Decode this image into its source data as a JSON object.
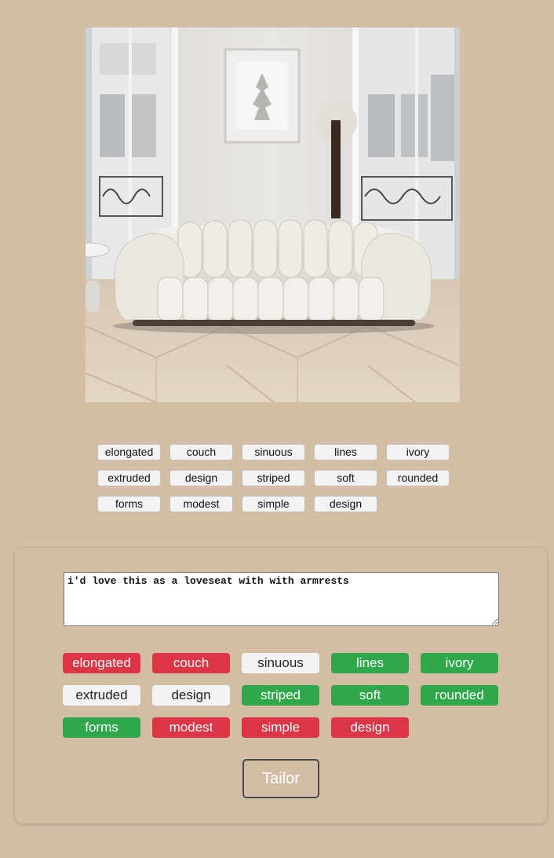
{
  "photo": {
    "subject": "white channel-tufted curved sofa in a bright room"
  },
  "suggested_tags": [
    {
      "label": "elongated"
    },
    {
      "label": "couch"
    },
    {
      "label": "sinuous"
    },
    {
      "label": "lines"
    },
    {
      "label": "ivory"
    },
    {
      "label": "extruded"
    },
    {
      "label": "design"
    },
    {
      "label": "striped"
    },
    {
      "label": "soft"
    },
    {
      "label": "rounded"
    },
    {
      "label": "forms"
    },
    {
      "label": "modest"
    },
    {
      "label": "simple"
    },
    {
      "label": "design"
    }
  ],
  "request": {
    "value": "i'd love this as a loveseat with with armrests"
  },
  "selected_tags": [
    {
      "label": "elongated",
      "state": "red"
    },
    {
      "label": "couch",
      "state": "red"
    },
    {
      "label": "sinuous",
      "state": "neutral"
    },
    {
      "label": "lines",
      "state": "green"
    },
    {
      "label": "ivory",
      "state": "green"
    },
    {
      "label": "extruded",
      "state": "neutral"
    },
    {
      "label": "design",
      "state": "neutral"
    },
    {
      "label": "striped",
      "state": "green"
    },
    {
      "label": "soft",
      "state": "green"
    },
    {
      "label": "rounded",
      "state": "green"
    },
    {
      "label": "forms",
      "state": "green"
    },
    {
      "label": "modest",
      "state": "red"
    },
    {
      "label": "simple",
      "state": "red"
    },
    {
      "label": "design",
      "state": "red"
    }
  ],
  "actions": {
    "tailor_label": "Tailor"
  },
  "colors": {
    "background": "#d3bea5",
    "tag_red": "#dc3545",
    "tag_green": "#2ea84a",
    "tag_neutral": "#f3f3f3"
  }
}
